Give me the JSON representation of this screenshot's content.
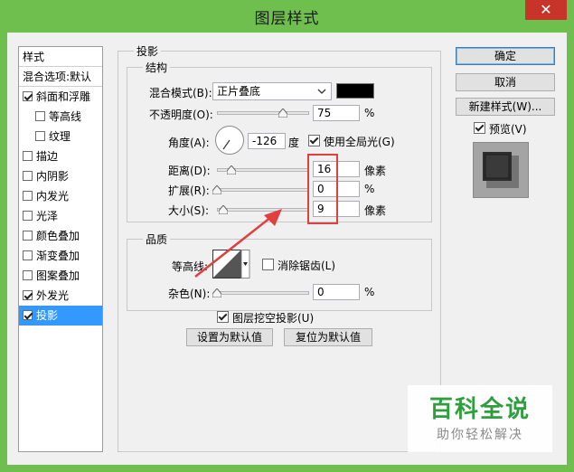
{
  "window": {
    "title": "图层样式",
    "close_glyph": "✕"
  },
  "left_list": {
    "header": "样式",
    "items": [
      {
        "label": "混合选项:默认",
        "has_checkbox": false,
        "checked": false,
        "selected": false
      },
      {
        "label": "斜面和浮雕",
        "has_checkbox": true,
        "checked": true,
        "selected": false
      },
      {
        "label": "等高线",
        "has_checkbox": true,
        "checked": false,
        "selected": false
      },
      {
        "label": "纹理",
        "has_checkbox": true,
        "checked": false,
        "selected": false
      },
      {
        "label": "描边",
        "has_checkbox": true,
        "checked": false,
        "selected": false
      },
      {
        "label": "内阴影",
        "has_checkbox": true,
        "checked": false,
        "selected": false
      },
      {
        "label": "内发光",
        "has_checkbox": true,
        "checked": false,
        "selected": false
      },
      {
        "label": "光泽",
        "has_checkbox": true,
        "checked": false,
        "selected": false
      },
      {
        "label": "颜色叠加",
        "has_checkbox": true,
        "checked": false,
        "selected": false
      },
      {
        "label": "渐变叠加",
        "has_checkbox": true,
        "checked": false,
        "selected": false
      },
      {
        "label": "图案叠加",
        "has_checkbox": true,
        "checked": false,
        "selected": false
      },
      {
        "label": "外发光",
        "has_checkbox": true,
        "checked": true,
        "selected": false
      },
      {
        "label": "投影",
        "has_checkbox": true,
        "checked": true,
        "selected": true
      }
    ]
  },
  "drop_shadow": {
    "legend": "投影",
    "structure": {
      "legend": "结构",
      "blend_mode_label": "混合模式(B):",
      "blend_mode_value": "正片叠底",
      "shadow_color": "#000000",
      "opacity_label": "不透明度(O):",
      "opacity_value": "75",
      "opacity_unit": "%",
      "angle_label": "角度(A):",
      "angle_value": "-126",
      "angle_unit": "度",
      "global_light_label": "使用全局光(G)",
      "global_light_checked": true,
      "distance_label": "距离(D):",
      "distance_value": "16",
      "distance_unit": "像素",
      "spread_label": "扩展(R):",
      "spread_value": "0",
      "spread_unit": "%",
      "size_label": "大小(S):",
      "size_value": "9",
      "size_unit": "像素"
    },
    "quality": {
      "legend": "品质",
      "contour_label": "等高线:",
      "antialias_label": "消除锯齿(L)",
      "antialias_checked": false,
      "noise_label": "杂色(N):",
      "noise_value": "0",
      "noise_unit": "%"
    },
    "knockout_label": "图层挖空投影(U)",
    "knockout_checked": true,
    "make_default_label": "设置为默认值",
    "reset_default_label": "复位为默认值"
  },
  "side_buttons": {
    "ok": "确定",
    "cancel": "取消",
    "new_style": "新建样式(W)...",
    "preview_label": "预览(V)",
    "preview_checked": true
  },
  "watermark": {
    "title": "百科全说",
    "subtitle": "助你轻松解决"
  },
  "colors": {
    "title_bar": "#6fbf4e",
    "selected": "#3399ff",
    "highlight": "#e04040",
    "watermark": "#2e9e3e"
  }
}
